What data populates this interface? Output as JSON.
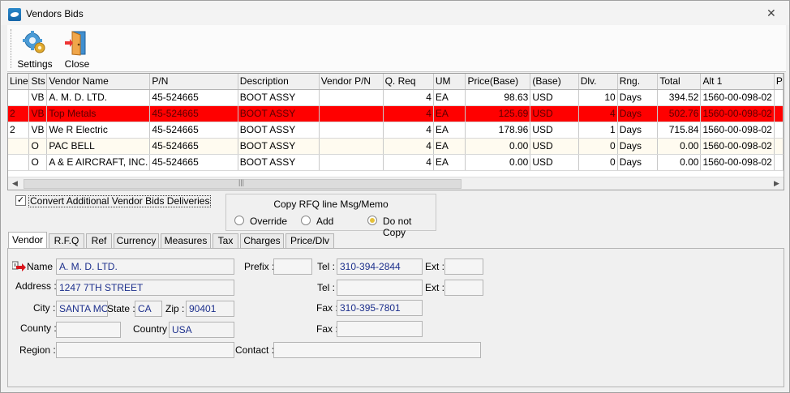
{
  "window": {
    "title": "Vendors Bids",
    "close_glyph": "✕"
  },
  "toolbar": {
    "settings_label": "Settings",
    "close_label": "Close"
  },
  "grid": {
    "columns": [
      "Line",
      "Sts",
      "Vendor Name",
      "P/N",
      "Description",
      "Vendor P/N",
      "Q. Req",
      "UM",
      "Price(Base)",
      "(Base)",
      "Dlv.",
      "Rng.",
      "Total",
      "Alt 1",
      "P"
    ],
    "rows": [
      {
        "line": "",
        "sts": "VB",
        "vendor": "A. M. D. LTD.",
        "pn": "45-524665",
        "desc": "BOOT ASSY",
        "vpn": "",
        "qreq": "4",
        "um": "EA",
        "price": "98.63",
        "base": "USD",
        "dlv": "10",
        "rng": "Days",
        "total": "394.52",
        "alt1": "1560-00-098-02",
        "style": "normal"
      },
      {
        "line": "2",
        "sts": "VB",
        "vendor": "Top Metals",
        "pn": "45-524665",
        "desc": "BOOT ASSY",
        "vpn": "",
        "qreq": "4",
        "um": "EA",
        "price": "125.69",
        "base": "USD",
        "dlv": "4",
        "rng": "Days",
        "total": "502.76",
        "alt1": "1560-00-098-02",
        "style": "red"
      },
      {
        "line": "2",
        "sts": "VB",
        "vendor": "We R Electric",
        "pn": "45-524665",
        "desc": "BOOT ASSY",
        "vpn": "",
        "qreq": "4",
        "um": "EA",
        "price": "178.96",
        "base": "USD",
        "dlv": "1",
        "rng": "Days",
        "total": "715.84",
        "alt1": "1560-00-098-02",
        "style": "normal"
      },
      {
        "line": "",
        "sts": "O",
        "vendor": "PAC BELL",
        "pn": "45-524665",
        "desc": "BOOT ASSY",
        "vpn": "",
        "qreq": "4",
        "um": "EA",
        "price": "0.00",
        "base": "USD",
        "dlv": "0",
        "rng": "Days",
        "total": "0.00",
        "alt1": "1560-00-098-02",
        "style": "alt"
      },
      {
        "line": "",
        "sts": "O",
        "vendor": "A & E AIRCRAFT, INC.",
        "pn": "45-524665",
        "desc": "BOOT ASSY",
        "vpn": "",
        "qreq": "4",
        "um": "EA",
        "price": "0.00",
        "base": "USD",
        "dlv": "0",
        "rng": "Days",
        "total": "0.00",
        "alt1": "1560-00-098-02",
        "style": "normal"
      }
    ],
    "scroll_left_glyph": "◀",
    "scroll_right_glyph": "▶",
    "thumb_grip": "|||"
  },
  "options": {
    "convert_label": "Convert Additional Vendor Bids Deliveries",
    "convert_checked": true,
    "check_glyph": "✓",
    "copy_group_title": "Copy RFQ line Msg/Memo",
    "radio_override": "Override",
    "radio_add": "Add",
    "radio_do_not_copy": "Do not Copy",
    "radio_selected": "do_not_copy"
  },
  "tabs": [
    "Vendor",
    "R.F.Q",
    "Ref",
    "Currency",
    "Measures",
    "Tax",
    "Charges",
    "Price/Dlv"
  ],
  "active_tab": "Vendor",
  "vendor": {
    "name_label": "Name",
    "name": "A. M. D. LTD.",
    "address_label": "Address :",
    "address": "1247 7TH STREET",
    "city_label": "City :",
    "city": "SANTA MONICA",
    "state_label": "State :",
    "state": "CA",
    "zip_label": "Zip :",
    "zip": "90401",
    "county_label": "County :",
    "county": "",
    "country_label": "Country :",
    "country": "USA",
    "region_label": "Region :",
    "region": "",
    "prefix_label": "Prefix :",
    "prefix": "",
    "tel1_label": "Tel :",
    "tel1": "310-394-2844",
    "ext1_label": "Ext :",
    "ext1": "",
    "tel2_label": "Tel :",
    "tel2": "",
    "ext2_label": "Ext :",
    "ext2": "",
    "fax1_label": "Fax :",
    "fax1": "310-395-7801",
    "fax2_label": "Fax :",
    "fax2": "",
    "contact_label": "Contact :",
    "contact": ""
  },
  "colors": {
    "selected_row": "#ff0000",
    "field_text": "#1c2f8c",
    "radio_selected": "#e5c13a"
  }
}
